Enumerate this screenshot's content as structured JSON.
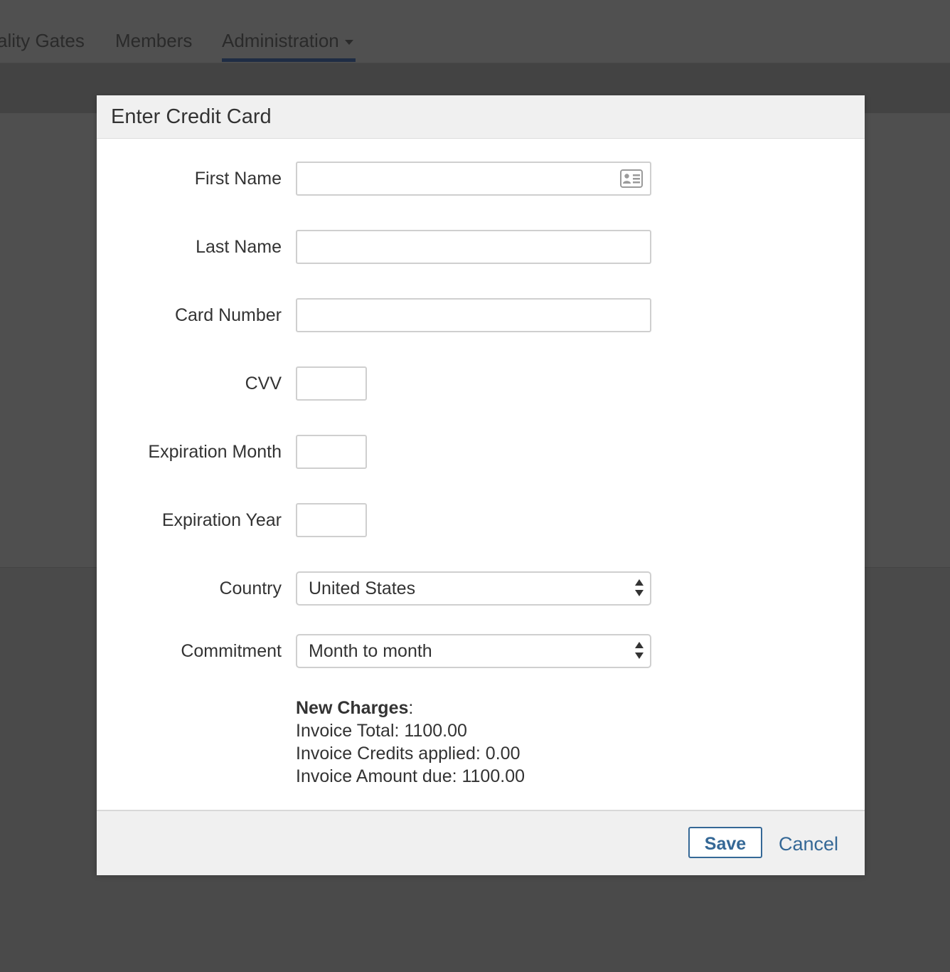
{
  "nav": {
    "items": [
      {
        "label": "ality Gates"
      },
      {
        "label": "Members"
      },
      {
        "label": "Administration"
      }
    ]
  },
  "modal": {
    "title": "Enter Credit Card",
    "fields": {
      "first_name": {
        "label": "First Name",
        "value": ""
      },
      "last_name": {
        "label": "Last Name",
        "value": ""
      },
      "card_number": {
        "label": "Card Number",
        "value": ""
      },
      "cvv": {
        "label": "CVV",
        "value": ""
      },
      "expiration_month": {
        "label": "Expiration Month",
        "value": ""
      },
      "expiration_year": {
        "label": "Expiration Year",
        "value": ""
      },
      "country": {
        "label": "Country",
        "value": "United States"
      },
      "commitment": {
        "label": "Commitment",
        "value": "Month to month"
      }
    },
    "charges": {
      "title": "New Charges",
      "invoice_total": "Invoice Total: 1100.00",
      "invoice_credits": "Invoice Credits applied: 0.00",
      "invoice_amount_due": "Invoice Amount due: 1100.00"
    },
    "footer": {
      "save_label": "Save",
      "cancel_label": "Cancel"
    }
  },
  "colors": {
    "accent": "#356896",
    "overlay": "#4a4a4a",
    "header_bg": "#f0f0f0"
  },
  "icons": {
    "first_name_autofill": "contact-card-icon",
    "select_arrows": "updown-arrows-icon",
    "nav_dropdown": "caret-down-icon"
  }
}
